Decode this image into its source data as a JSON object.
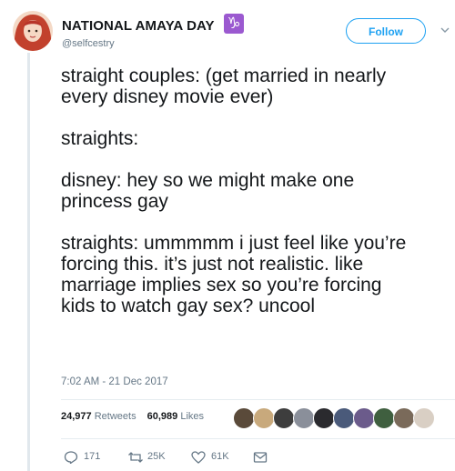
{
  "tweet": {
    "display_name": "NATIONAL AMAYA DAY",
    "badge_glyph": "♑",
    "handle": "@selfcestry",
    "follow_label": "Follow",
    "text": "straight couples: (get married in nearly\nevery disney movie ever)\n\nstraights:\n\ndisney: hey so we might make one\nprincess gay\n\nstraights: ummmmm i just feel like you’re\nforcing this. it’s just not realistic. like\nmarriage implies sex so you’re forcing\nkids to watch gay sex? uncool",
    "timestamp": "7:02 AM - 21 Dec 2017"
  },
  "stats": {
    "retweets_count": "24,977",
    "retweets_label": "Retweets",
    "likes_count": "60,989",
    "likes_label": "Likes"
  },
  "actions": {
    "reply_count": "171",
    "retweet_count": "25K",
    "like_count": "61K"
  },
  "icons": {
    "reply": "reply-icon",
    "retweet": "retweet-icon",
    "like": "heart-icon",
    "message": "envelope-icon",
    "more": "chevron-down-icon"
  },
  "colors": {
    "accent": "#1da1f2",
    "text": "#14171a",
    "muted": "#657786",
    "badge": "#9b59d0"
  }
}
